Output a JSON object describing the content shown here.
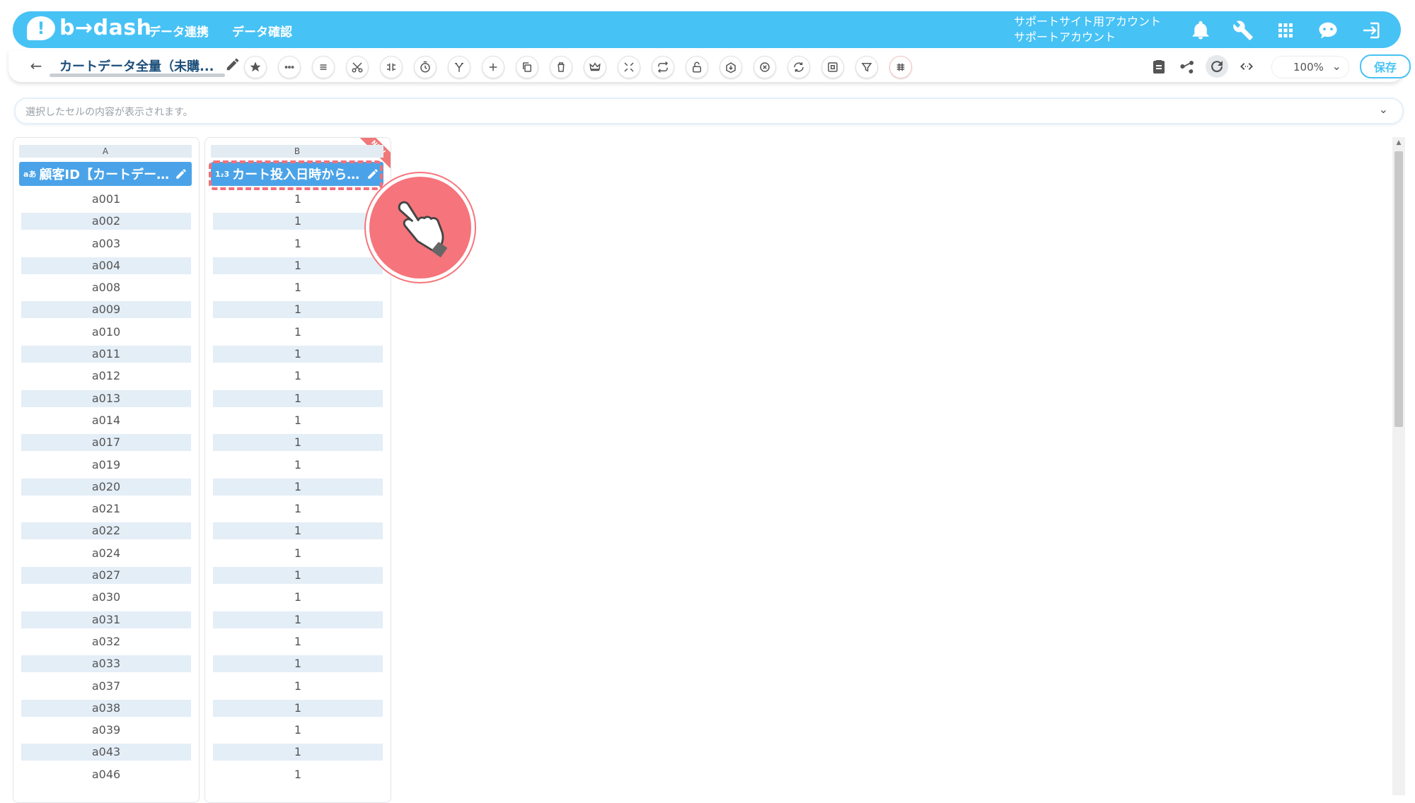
{
  "header": {
    "logo_mark": "!",
    "logo_text": "b→dash",
    "nav": [
      "データ連携",
      "データ確認"
    ],
    "account_line1": "サポートサイト用アカウント",
    "account_line2": "サポートアカウント",
    "icons": [
      "bell-icon",
      "wrench-icon",
      "apps-grid-icon",
      "chat-robot-icon",
      "logout-icon"
    ]
  },
  "toolbar": {
    "back_icon": "←",
    "sheet_name": "カートデータ全量（未購...",
    "tool_icons": [
      "star-icon",
      "more-icon",
      "list-icon",
      "scissors-icon",
      "merge-icon",
      "timer-icon",
      "branch-icon",
      "plus-icon",
      "copy-icon",
      "trash-icon",
      "crown-icon",
      "collapse-icon",
      "loop-icon",
      "unlock-icon",
      "download-box-icon",
      "cancel-icon",
      "convert-icon",
      "frame-icon",
      "filter-icon",
      "grid-icon"
    ],
    "zoom": "100%",
    "zoom_chevron": "⌄",
    "save_label": "保存"
  },
  "cell_preview": {
    "placeholder": "選択したセルの内容が表示されます。",
    "chevron": "⌄"
  },
  "columns": [
    {
      "letter": "A",
      "type_badge": "aあ",
      "title": "顧客ID【カートデー…",
      "cells": [
        "a001",
        "a002",
        "a003",
        "a004",
        "a008",
        "a009",
        "a010",
        "a011",
        "a012",
        "a013",
        "a014",
        "a017",
        "a019",
        "a020",
        "a021",
        "a022",
        "a024",
        "a027",
        "a030",
        "a031",
        "a032",
        "a033",
        "a037",
        "a038",
        "a039",
        "a043",
        "a046"
      ]
    },
    {
      "letter": "B",
      "type_badge": "1₂3",
      "title": "カート投入日時から…",
      "badge": "NEW",
      "cells": [
        "1",
        "1",
        "1",
        "1",
        "1",
        "1",
        "1",
        "1",
        "1",
        "1",
        "1",
        "1",
        "1",
        "1",
        "1",
        "1",
        "1",
        "1",
        "1",
        "1",
        "1",
        "1",
        "1",
        "1",
        "1",
        "1",
        "1"
      ]
    }
  ],
  "scrollbar": {
    "up_arrow": "▲"
  },
  "colors": {
    "accent": "#47c2f5",
    "header_blue": "#4aa3e8",
    "highlight": "#f2707a"
  }
}
